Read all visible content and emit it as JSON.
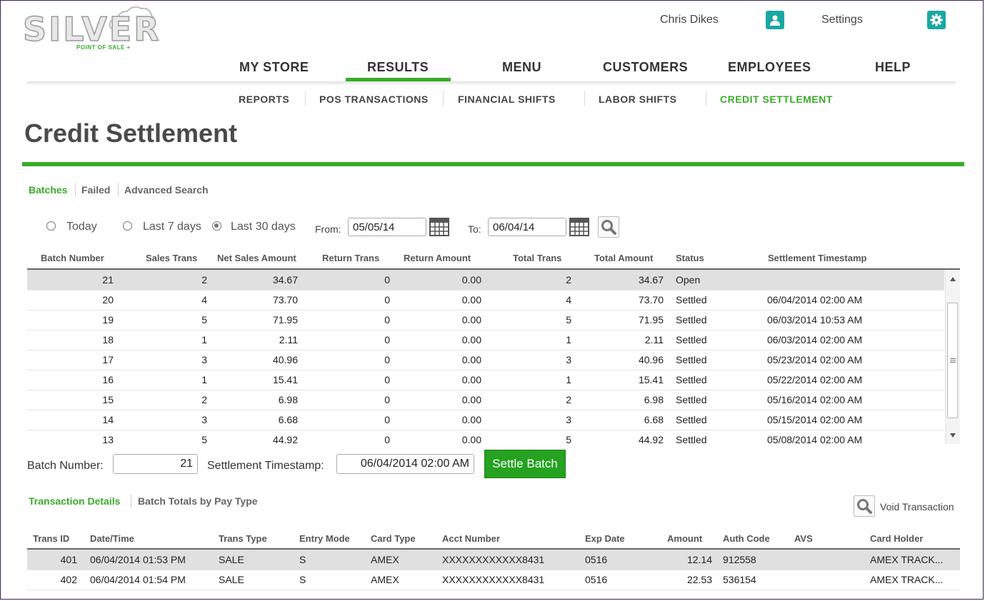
{
  "brand": {
    "name": "SILVER",
    "tagline": "POINT OF SALE +"
  },
  "header": {
    "user_name": "Chris Dikes",
    "settings_label": "Settings",
    "accent": "#3aab2a",
    "icon_color": "#1aa8a2"
  },
  "main_nav": {
    "items": [
      "MY STORE",
      "RESULTS",
      "MENU",
      "CUSTOMERS",
      "EMPLOYEES",
      "HELP"
    ],
    "active": "RESULTS"
  },
  "sub_nav": {
    "items": [
      "REPORTS",
      "POS TRANSACTIONS",
      "FINANCIAL SHIFTS",
      "LABOR SHIFTS",
      "CREDIT SETTLEMENT"
    ],
    "active": "CREDIT SETTLEMENT"
  },
  "page": {
    "title": "Credit Settlement"
  },
  "tabs": {
    "items": [
      "Batches",
      "Failed",
      "Advanced Search"
    ],
    "active": "Batches"
  },
  "filters": {
    "ranges": [
      "Today",
      "Last 7 days",
      "Last 30 days"
    ],
    "selected": "Last 30 days",
    "from_label": "From:",
    "from_value": "05/05/14",
    "to_label": "To:",
    "to_value": "06/04/14"
  },
  "batches": {
    "columns": [
      "Batch Number",
      "Sales Trans",
      "Net Sales Amount",
      "Return Trans",
      "Return Amount",
      "Total Trans",
      "Total Amount",
      "Status",
      "Settlement Timestamp"
    ],
    "rows": [
      [
        "21",
        "2",
        "34.67",
        "0",
        "0.00",
        "2",
        "34.67",
        "Open",
        ""
      ],
      [
        "20",
        "4",
        "73.70",
        "0",
        "0.00",
        "4",
        "73.70",
        "Settled",
        "06/04/2014 02:00 AM"
      ],
      [
        "19",
        "5",
        "71.95",
        "0",
        "0.00",
        "5",
        "71.95",
        "Settled",
        "06/03/2014 10:53 AM"
      ],
      [
        "18",
        "1",
        "2.11",
        "0",
        "0.00",
        "1",
        "2.11",
        "Settled",
        "06/03/2014 02:00 AM"
      ],
      [
        "17",
        "3",
        "40.96",
        "0",
        "0.00",
        "3",
        "40.96",
        "Settled",
        "05/23/2014 02:00 AM"
      ],
      [
        "16",
        "1",
        "15.41",
        "0",
        "0.00",
        "1",
        "15.41",
        "Settled",
        "05/22/2014 02:00 AM"
      ],
      [
        "15",
        "2",
        "6.98",
        "0",
        "0.00",
        "2",
        "6.98",
        "Settled",
        "05/16/2014 02:00 AM"
      ],
      [
        "14",
        "3",
        "6.68",
        "0",
        "0.00",
        "3",
        "6.68",
        "Settled",
        "05/15/2014 02:00 AM"
      ],
      [
        "13",
        "5",
        "44.92",
        "0",
        "0.00",
        "5",
        "44.92",
        "Settled",
        "05/08/2014 02:00 AM"
      ]
    ],
    "selected_index": 0
  },
  "settle_form": {
    "batch_label": "Batch Number:",
    "batch_value": "21",
    "timestamp_label": "Settlement Timestamp:",
    "timestamp_value": "06/04/2014 02:00 AM",
    "settle_button": "Settle Batch"
  },
  "detail_tabs": {
    "items": [
      "Transaction Details",
      "Batch Totals by Pay Type"
    ],
    "active": "Transaction Details"
  },
  "void_label": "Void Transaction",
  "transactions": {
    "columns": [
      "Trans ID",
      "Date/Time",
      "Trans Type",
      "Entry Mode",
      "Card Type",
      "Acct Number",
      "Exp Date",
      "Amount",
      "Auth Code",
      "AVS",
      "Card Holder"
    ],
    "rows": [
      [
        "401",
        "06/04/2014 01:53 PM",
        "SALE",
        "S",
        "AMEX",
        "XXXXXXXXXXXX8431",
        "0516",
        "12.14",
        "912558",
        "",
        "AMEX TRACK..."
      ],
      [
        "402",
        "06/04/2014 01:54 PM",
        "SALE",
        "S",
        "AMEX",
        "XXXXXXXXXXXX8431",
        "0516",
        "22.53",
        "536154",
        "",
        "AMEX TRACK..."
      ]
    ],
    "selected_index": 0
  }
}
